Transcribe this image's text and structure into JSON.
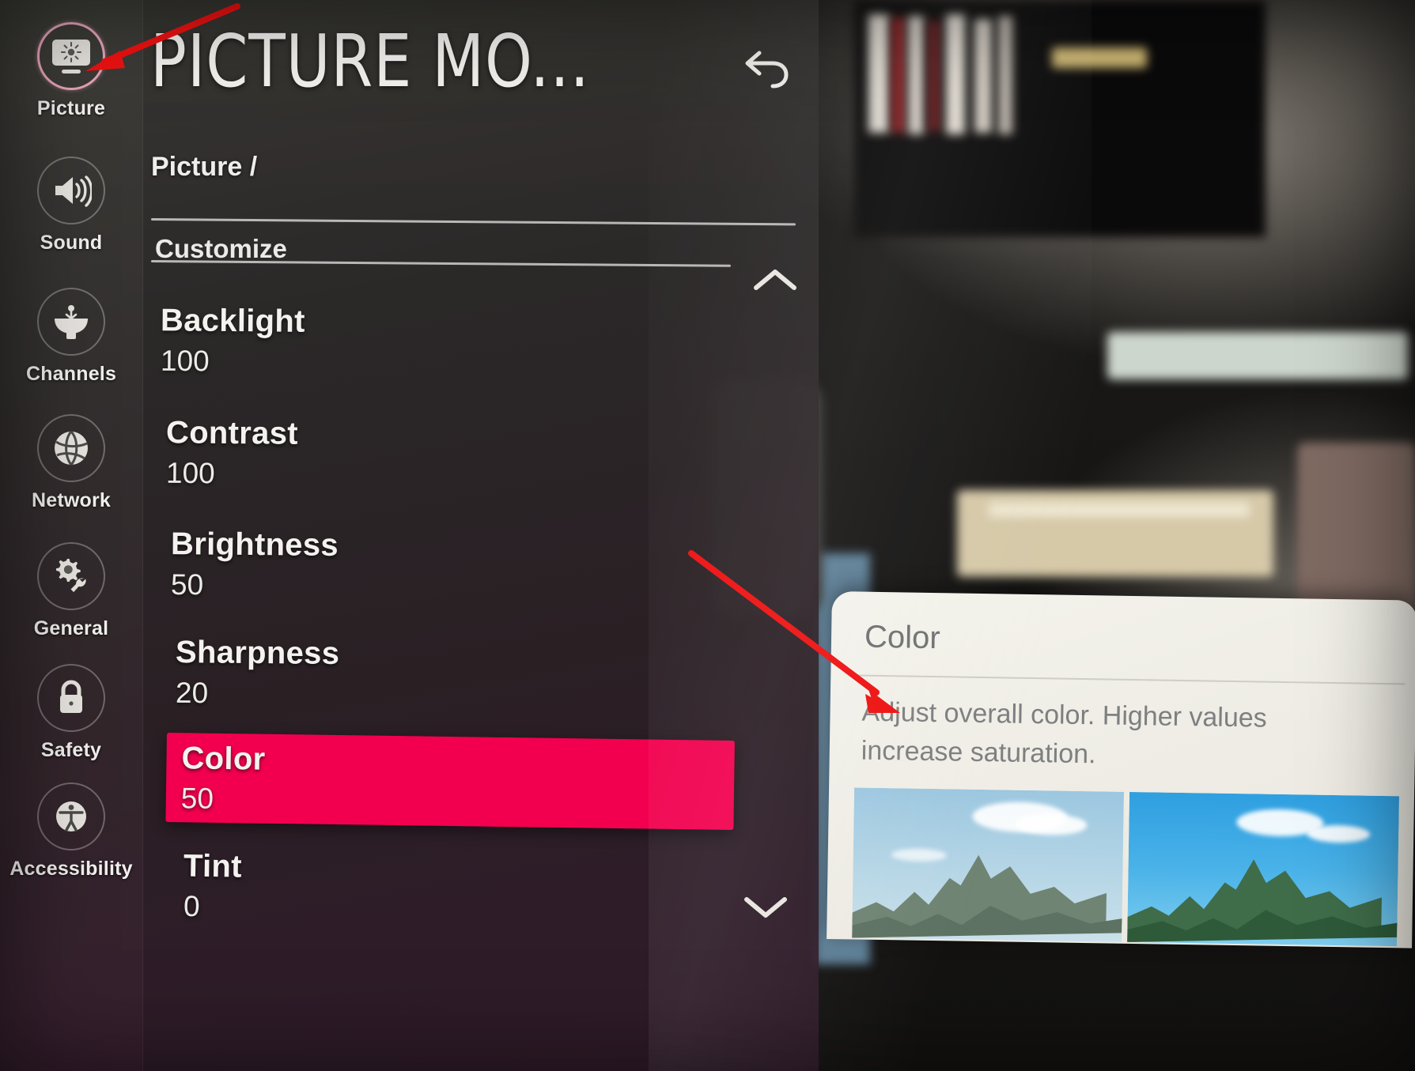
{
  "header": {
    "title": "PICTURE MO...",
    "back_icon": "undo-arrow-icon"
  },
  "breadcrumb": "Picture /",
  "section_label": "Customize",
  "scroll": {
    "up_icon": "chevron-up-icon",
    "down_icon": "chevron-down-icon"
  },
  "sidebar": {
    "items": [
      {
        "label": "Picture",
        "icon": "picture-brightness-icon",
        "selected": true
      },
      {
        "label": "Sound",
        "icon": "speaker-icon",
        "selected": false
      },
      {
        "label": "Channels",
        "icon": "satellite-dish-icon",
        "selected": false
      },
      {
        "label": "Network",
        "icon": "globe-icon",
        "selected": false
      },
      {
        "label": "General",
        "icon": "gear-wrench-icon",
        "selected": false
      },
      {
        "label": "Safety",
        "icon": "lock-icon",
        "selected": false
      },
      {
        "label": "Accessibility",
        "icon": "accessibility-icon",
        "selected": false
      }
    ]
  },
  "settings": {
    "items": [
      {
        "name": "Backlight",
        "value": "100",
        "highlighted": false
      },
      {
        "name": "Contrast",
        "value": "100",
        "highlighted": false
      },
      {
        "name": "Brightness",
        "value": "50",
        "highlighted": false
      },
      {
        "name": "Sharpness",
        "value": "20",
        "highlighted": false
      },
      {
        "name": "Color",
        "value": "50",
        "highlighted": true
      },
      {
        "name": "Tint",
        "value": "0",
        "highlighted": false
      }
    ]
  },
  "tooltip": {
    "title": "Color",
    "body": "Adjust overall color. Higher values increase saturation.",
    "preview_left": "desaturated-mountain-thumbnail",
    "preview_right": "saturated-mountain-thumbnail"
  },
  "annotations": [
    {
      "name": "arrow-to-picture-icon",
      "color": "#ee1111"
    },
    {
      "name": "arrow-to-color-description",
      "color": "#ee1111"
    }
  ],
  "colors": {
    "highlight": "#f2004f",
    "selected_ring": "#e6a4bb",
    "annotation": "#ee1111",
    "tooltip_bg": "#f1efe7"
  }
}
